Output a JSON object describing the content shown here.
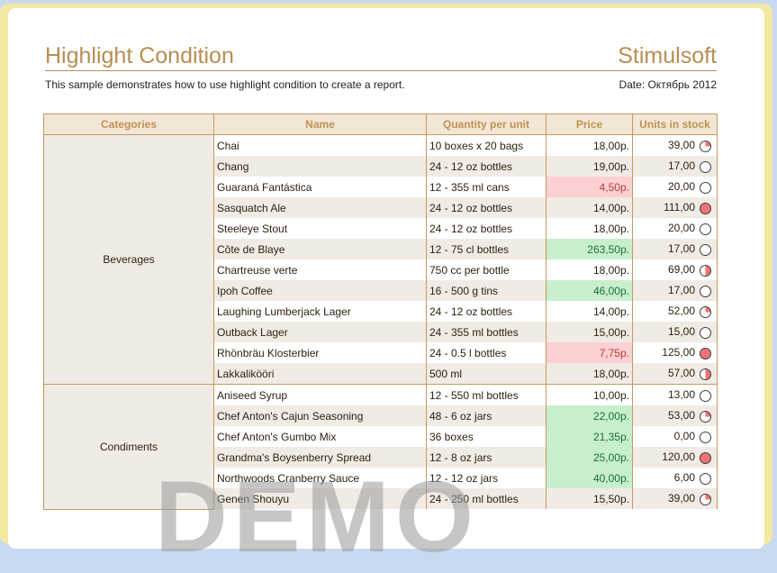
{
  "report": {
    "title": "Highlight Condition",
    "brand": "Stimulsoft",
    "description": "This sample demonstrates how to use highlight condition to create a report.",
    "date": "Date: Октябрь 2012",
    "watermark": "DEMO"
  },
  "columns": [
    "Categories",
    "Name",
    "Quantity per unit",
    "Price",
    "Units in stock"
  ],
  "groups": [
    {
      "category": "Beverages",
      "rows": [
        {
          "name": "Chai",
          "qty": "10 boxes x 20 bags",
          "price": "18,00р.",
          "highlight": "none",
          "stock": "39,00",
          "level": 0.25
        },
        {
          "name": "Chang",
          "qty": "24 - 12 oz bottles",
          "price": "19,00р.",
          "highlight": "none",
          "stock": "17,00",
          "level": 0
        },
        {
          "name": "Guaraná Fantástica",
          "qty": "12 - 355 ml cans",
          "price": "4,50р.",
          "highlight": "low",
          "stock": "20,00",
          "level": 0
        },
        {
          "name": "Sasquatch Ale",
          "qty": "24 - 12 oz bottles",
          "price": "14,00р.",
          "highlight": "none",
          "stock": "111,00",
          "level": 1
        },
        {
          "name": "Steeleye Stout",
          "qty": "24 - 12 oz bottles",
          "price": "18,00р.",
          "highlight": "none",
          "stock": "20,00",
          "level": 0
        },
        {
          "name": "Côte de Blaye",
          "qty": "12 - 75 cl bottles",
          "price": "263,50р.",
          "highlight": "high",
          "stock": "17,00",
          "level": 0
        },
        {
          "name": "Chartreuse verte",
          "qty": "750 cc per bottle",
          "price": "18,00р.",
          "highlight": "none",
          "stock": "69,00",
          "level": 0.5
        },
        {
          "name": "Ipoh Coffee",
          "qty": "16 - 500 g tins",
          "price": "46,00р.",
          "highlight": "high",
          "stock": "17,00",
          "level": 0
        },
        {
          "name": "Laughing Lumberjack Lager",
          "qty": "24 - 12 oz bottles",
          "price": "14,00р.",
          "highlight": "none",
          "stock": "52,00",
          "level": 0.25
        },
        {
          "name": "Outback Lager",
          "qty": "24 - 355 ml bottles",
          "price": "15,00р.",
          "highlight": "none",
          "stock": "15,00",
          "level": 0
        },
        {
          "name": "Rhönbräu Klosterbier",
          "qty": "24 - 0.5 l bottles",
          "price": "7,75р.",
          "highlight": "low",
          "stock": "125,00",
          "level": 1
        },
        {
          "name": "Lakkalikööri",
          "qty": "500 ml",
          "price": "18,00р.",
          "highlight": "none",
          "stock": "57,00",
          "level": 0.5
        }
      ]
    },
    {
      "category": "Condiments",
      "rows": [
        {
          "name": "Aniseed Syrup",
          "qty": "12 - 550 ml bottles",
          "price": "10,00р.",
          "highlight": "none",
          "stock": "13,00",
          "level": 0
        },
        {
          "name": "Chef Anton's Cajun Seasoning",
          "qty": "48 - 6 oz jars",
          "price": "22,00р.",
          "highlight": "high",
          "stock": "53,00",
          "level": 0.25
        },
        {
          "name": "Chef Anton's Gumbo Mix",
          "qty": "36 boxes",
          "price": "21,35р.",
          "highlight": "high",
          "stock": "0,00",
          "level": 0
        },
        {
          "name": "Grandma's Boysenberry Spread",
          "qty": "12 - 8 oz jars",
          "price": "25,00р.",
          "highlight": "high",
          "stock": "120,00",
          "level": 1
        },
        {
          "name": "Northwoods Cranberry Sauce",
          "qty": "12 - 12 oz jars",
          "price": "40,00р.",
          "highlight": "high",
          "stock": "6,00",
          "level": 0
        },
        {
          "name": "Genen Shouyu",
          "qty": "24 - 250 ml bottles",
          "price": "15,50р.",
          "highlight": "none",
          "stock": "39,00",
          "level": 0.25
        }
      ]
    }
  ]
}
